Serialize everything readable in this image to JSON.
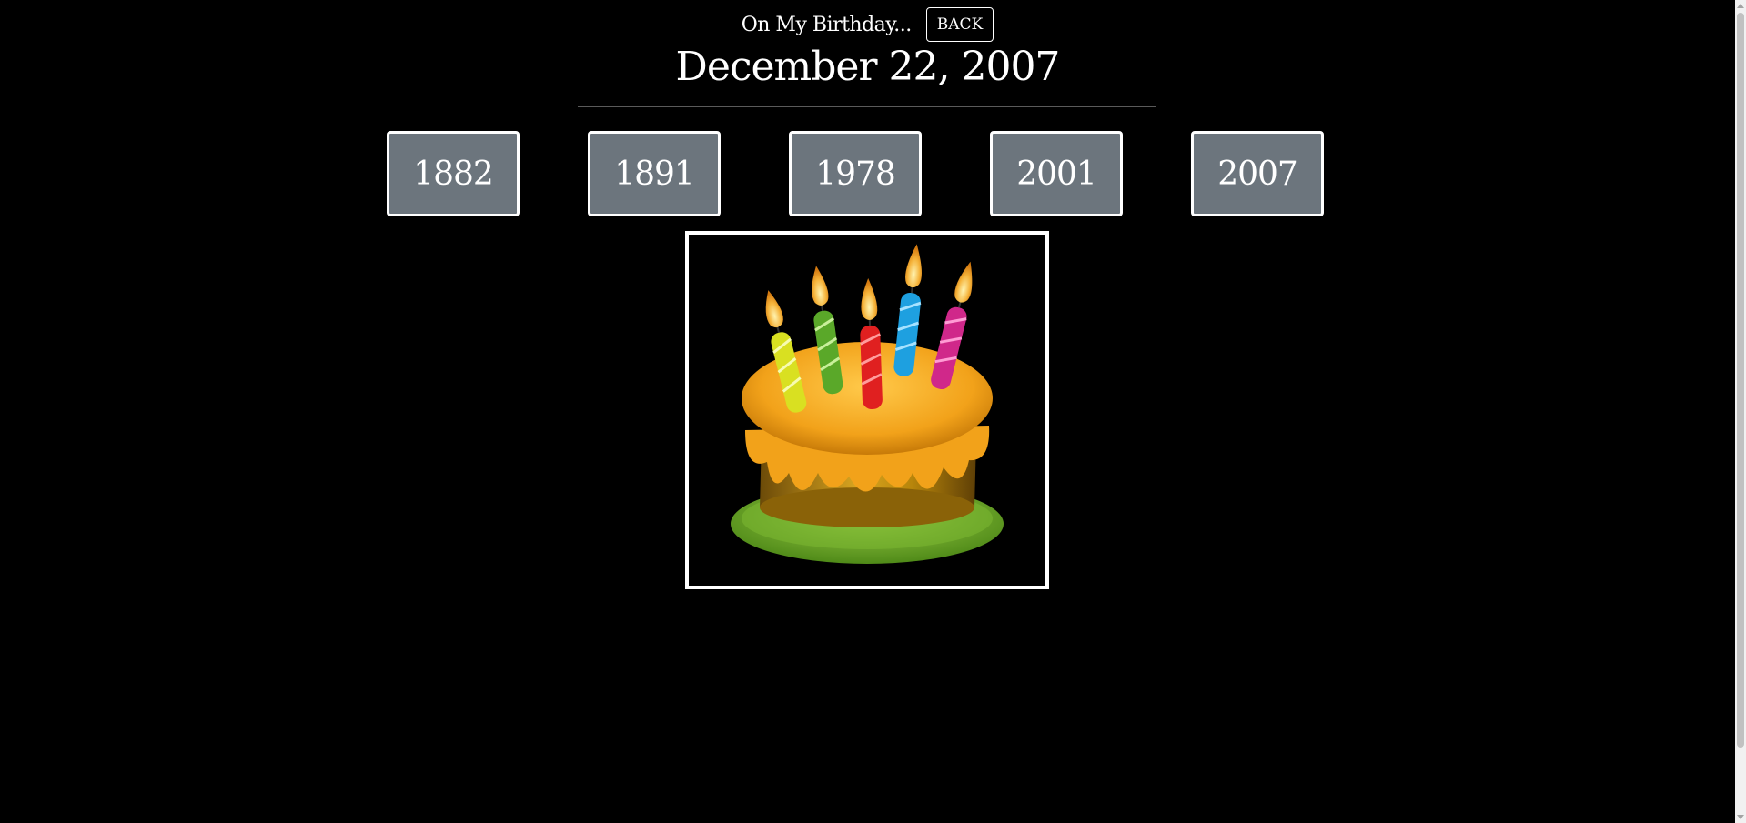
{
  "header": {
    "subtitle": "On My Birthday...",
    "back_label": "BACK"
  },
  "main": {
    "date_title": "December 22, 2007",
    "years": [
      "1882",
      "1891",
      "1978",
      "2001",
      "2007"
    ],
    "image": {
      "icon": "birthday-cake",
      "colors": {
        "frosting": "#f2a21a",
        "cake": "#b8860b",
        "plate": "#6fa62a",
        "candles": [
          "#d9e021",
          "#5aa829",
          "#e02020",
          "#1ea0e0",
          "#d0288a"
        ]
      }
    }
  },
  "colors": {
    "background": "#000000",
    "year_button_bg": "#6c757d",
    "border": "#ffffff"
  }
}
